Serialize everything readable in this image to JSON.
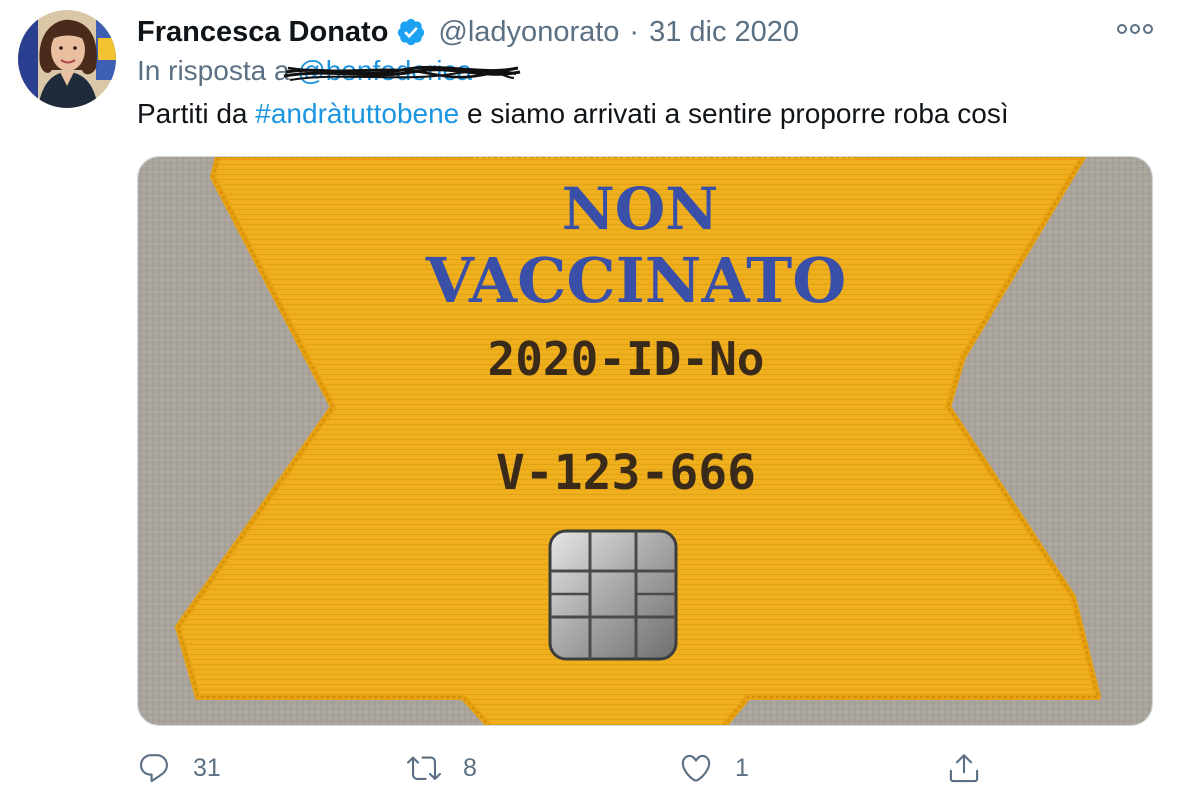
{
  "tweet": {
    "author_name": "Francesca Donato",
    "handle": "@ladyonorato",
    "separator": "·",
    "date": "31 dic 2020",
    "reply_prefix": "In risposta a",
    "reply_user": "@benfederica",
    "text_before": "Partiti da ",
    "hashtag": "#andràtuttobene",
    "text_after": " e siamo arrivati a sentire proporre roba così"
  },
  "media": {
    "line1": "NON",
    "line2": "VACCINATO",
    "line3": "2020-ID-No",
    "line4": "V-123-666"
  },
  "actions": {
    "reply_count": "31",
    "retweet_count": "8",
    "like_count": "1"
  },
  "colors": {
    "link": "#1b95e0",
    "muted": "#5b7083",
    "verified": "#1da1f2",
    "star": "#f0b21f",
    "fabric": "#a8a39a"
  },
  "icons": [
    "verified-badge-icon",
    "more-icon",
    "reply-icon",
    "retweet-icon",
    "like-icon",
    "share-icon"
  ]
}
